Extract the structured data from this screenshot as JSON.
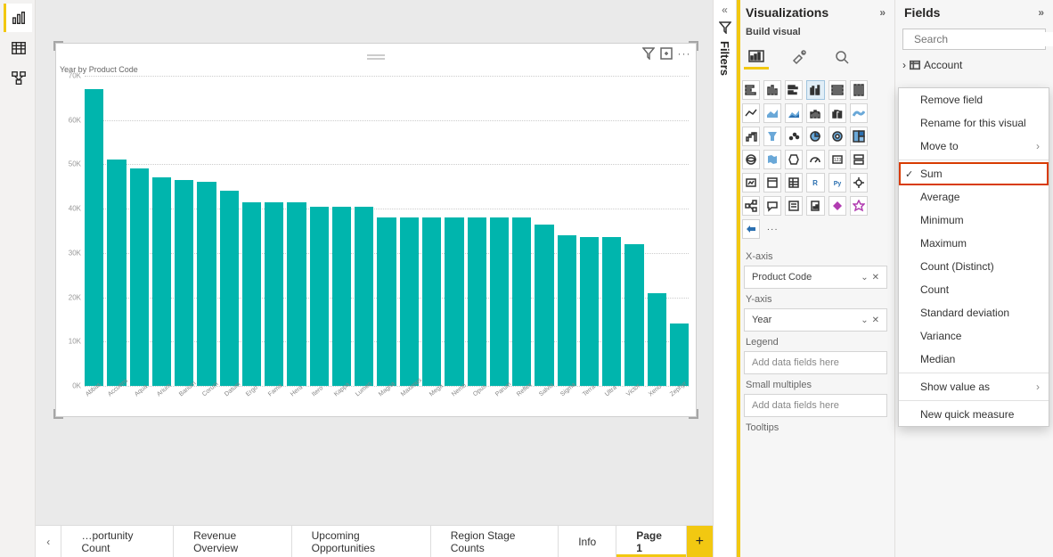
{
  "left_views": [
    "Report",
    "Data",
    "Model"
  ],
  "filters_label": "Filters",
  "viz_panel": {
    "title": "Visualizations",
    "subtitle": "Build visual",
    "field_wells": {
      "x_axis": {
        "label": "X-axis",
        "value": "Product Code"
      },
      "y_axis": {
        "label": "Y-axis",
        "value": "Year"
      },
      "legend": {
        "label": "Legend",
        "placeholder": "Add data fields here"
      },
      "small_multiples": {
        "label": "Small multiples",
        "placeholder": "Add data fields here"
      },
      "tooltips": {
        "label": "Tooltips"
      }
    }
  },
  "fields_panel": {
    "title": "Fields",
    "search_placeholder": "Search",
    "tree": {
      "item1": "Account"
    }
  },
  "context_menu": {
    "remove": "Remove field",
    "rename": "Rename for this visual",
    "move_to": "Move to",
    "sum": "Sum",
    "average": "Average",
    "minimum": "Minimum",
    "maximum": "Maximum",
    "count_distinct": "Count (Distinct)",
    "count": "Count",
    "stddev": "Standard deviation",
    "variance": "Variance",
    "median": "Median",
    "show_as": "Show value as",
    "new_quick": "New quick measure"
  },
  "tabs": {
    "t1": "…portunity Count",
    "t2": "Revenue Overview",
    "t3": "Upcoming Opportunities",
    "t4": "Region Stage Counts",
    "t5": "Info",
    "t6": "Page 1"
  },
  "chart_data": {
    "type": "bar",
    "title": "Year by Product Code",
    "xlabel": "",
    "ylabel": "",
    "ylim": [
      0,
      70000
    ],
    "yticks": [
      "0K",
      "10K",
      "20K",
      "30K",
      "40K",
      "50K",
      "60K",
      "70K"
    ],
    "categories": [
      "Abbas",
      "Accuens",
      "Aqua",
      "Arium",
      "Barium",
      "Corum",
      "Datum",
      "Ergo",
      "Fama",
      "Hera",
      "Itero",
      "Kappa",
      "Lumen",
      "Magna",
      "Maximus",
      "Mega",
      "Nemo",
      "Opus",
      "Parum",
      "Reflex",
      "Salvia",
      "Sigma",
      "Terra",
      "Ultra",
      "Victor",
      "Xeno",
      "Zephyr"
    ],
    "values": [
      67000,
      51000,
      49000,
      47000,
      46500,
      46000,
      44000,
      41500,
      41500,
      41500,
      40500,
      40500,
      40500,
      38000,
      38000,
      38000,
      38000,
      38000,
      38000,
      38000,
      36500,
      34000,
      33500,
      33500,
      32000,
      21000,
      14000
    ]
  }
}
